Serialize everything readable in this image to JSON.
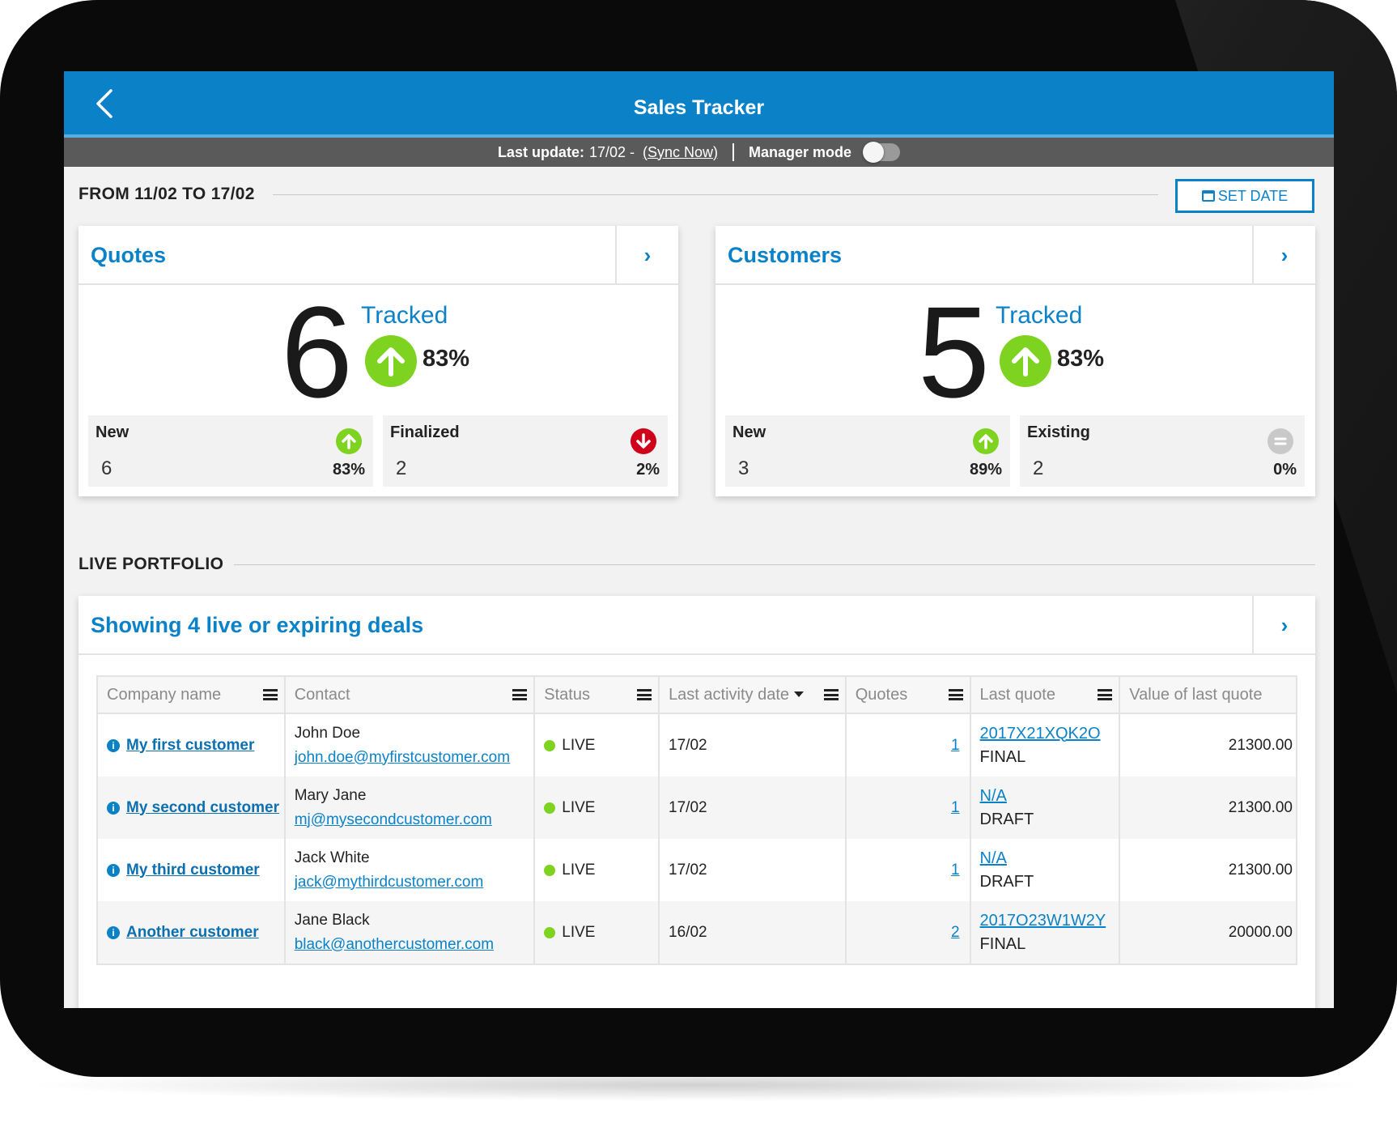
{
  "app": {
    "title": "Sales Tracker"
  },
  "syncbar": {
    "last_update_label": "Last update:",
    "last_update_date": "17/02 -",
    "sync_link": "(Sync Now)",
    "manager_mode_label": "Manager mode",
    "manager_mode_on": false
  },
  "period": {
    "label": "FROM 11/02 TO 17/02",
    "set_date_button": "SET DATE"
  },
  "quotes_card": {
    "title": "Quotes",
    "count": "6",
    "tracked_label": "Tracked",
    "tracked_pct": "83%",
    "stats": [
      {
        "label": "New",
        "value": "6",
        "pct": "83%",
        "trend": "up"
      },
      {
        "label": "Finalized",
        "value": "2",
        "pct": "2%",
        "trend": "down"
      }
    ]
  },
  "customers_card": {
    "title": "Customers",
    "count": "5",
    "tracked_label": "Tracked",
    "tracked_pct": "83%",
    "stats": [
      {
        "label": "New",
        "value": "3",
        "pct": "89%",
        "trend": "up"
      },
      {
        "label": "Existing",
        "value": "2",
        "pct": "0%",
        "trend": "flat"
      }
    ]
  },
  "portfolio": {
    "section_label": "LIVE PORTFOLIO",
    "title": "Showing 4 live or expiring deals",
    "columns": [
      "Company name",
      "Contact",
      "Status",
      "Last activity date",
      "Quotes",
      "Last quote",
      "Value of last quote"
    ],
    "sorted_column": "Last activity date",
    "rows": [
      {
        "company": "My first customer",
        "contact_name": "John Doe",
        "contact_email": "john.doe@myfirstcustomer.com",
        "status": "LIVE",
        "last_activity": "17/02",
        "quotes": "1",
        "last_quote_id": "2017X21XQK2O",
        "last_quote_state": "FINAL",
        "value": "21300.00"
      },
      {
        "company": "My second customer",
        "contact_name": "Mary Jane",
        "contact_email": "mj@mysecondcustomer.com",
        "status": "LIVE",
        "last_activity": "17/02",
        "quotes": "1",
        "last_quote_id": "N/A",
        "last_quote_state": "DRAFT",
        "value": "21300.00"
      },
      {
        "company": "My third customer",
        "contact_name": "Jack White",
        "contact_email": "jack@mythirdcustomer.com",
        "status": "LIVE",
        "last_activity": "17/02",
        "quotes": "1",
        "last_quote_id": "N/A",
        "last_quote_state": "DRAFT",
        "value": "21300.00"
      },
      {
        "company": "Another customer",
        "contact_name": "Jane Black",
        "contact_email": "black@anothercustomer.com",
        "status": "LIVE",
        "last_activity": "16/02",
        "quotes": "2",
        "last_quote_id": "2017O23W1W2Y",
        "last_quote_state": "FINAL",
        "value": "20000.00"
      }
    ]
  },
  "colors": {
    "brand_blue": "#0b82c7",
    "up_green": "#7ed321",
    "down_red": "#d0021b",
    "syncbar_gray": "#5a5a5a"
  }
}
